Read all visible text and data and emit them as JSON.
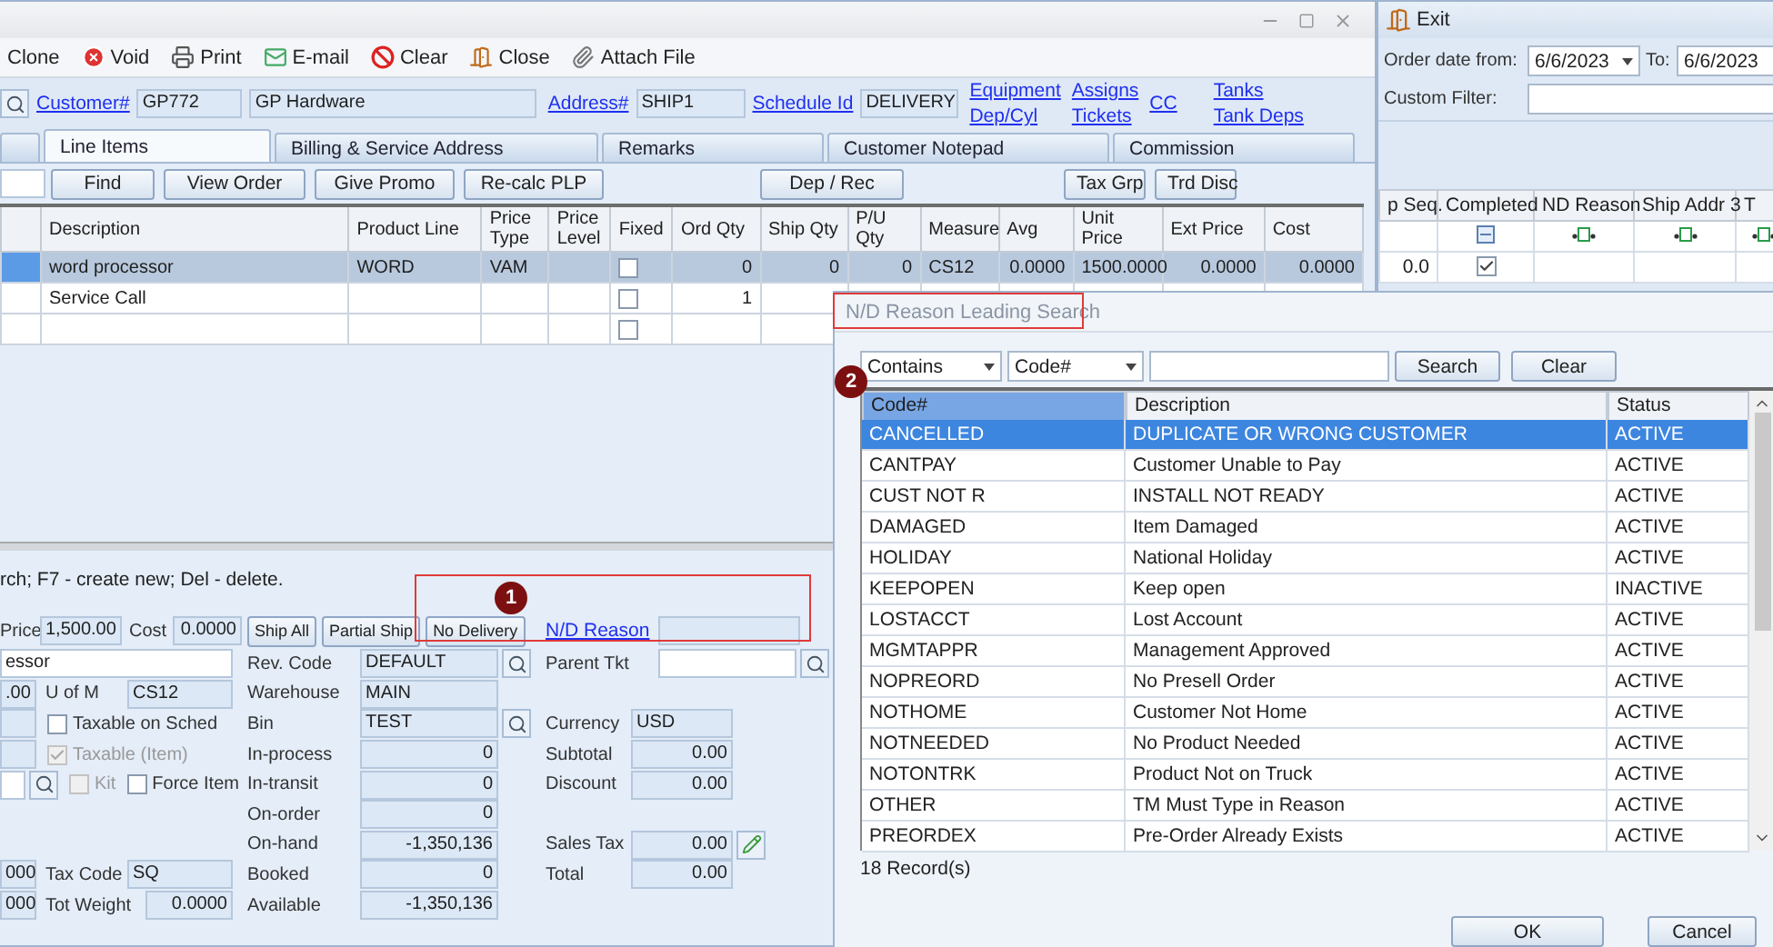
{
  "main_window": {
    "toolbar": [
      {
        "label": "Clone"
      },
      {
        "label": "Void"
      },
      {
        "label": "Print"
      },
      {
        "label": "E-mail"
      },
      {
        "label": "Clear"
      },
      {
        "label": "Close"
      },
      {
        "label": "Attach File"
      }
    ],
    "header": {
      "customer_link": "Customer#",
      "customer_id": "GP772",
      "customer_name": "GP Hardware",
      "address_link": "Address#",
      "address_id": "SHIP1",
      "schedule_link": "Schedule Id",
      "schedule_id": "DELIVERY",
      "link_columns": [
        {
          "links": [
            "Equipment",
            "Dep/Cyl"
          ]
        },
        {
          "links": [
            "Assigns",
            "Tickets"
          ]
        },
        {
          "links": [
            "CC"
          ]
        },
        {
          "links": [
            "Tanks",
            "Tank Deps"
          ]
        }
      ]
    },
    "tabs": [
      {
        "label": "Line Items",
        "selected": true
      },
      {
        "label": "Billing & Service Address",
        "selected": false
      },
      {
        "label": "Remarks",
        "selected": false
      },
      {
        "label": "Customer Notepad",
        "selected": false
      },
      {
        "label": "Commission",
        "selected": false
      }
    ],
    "button_groups": [
      {
        "buttons": [
          "Find",
          "View Order",
          "Give Promo",
          "Re-calc PLP"
        ]
      },
      {
        "buttons": [
          "Dep / Rec"
        ]
      },
      {
        "buttons": [
          "Tax Grp",
          "Trd Disc"
        ]
      }
    ],
    "grid": {
      "columns": [
        {
          "label": "Description",
          "kind": "text"
        },
        {
          "label": "Product Line",
          "kind": "text"
        },
        {
          "label": "Price Type",
          "kind": "text"
        },
        {
          "label": "Price Level",
          "kind": "text"
        },
        {
          "label": "Fixed",
          "kind": "check"
        },
        {
          "label": "Ord Qty",
          "kind": "number"
        },
        {
          "label": "Ship Qty",
          "kind": "number"
        },
        {
          "label": "P/U Qty",
          "kind": "number"
        },
        {
          "label": "Measure",
          "kind": "text"
        },
        {
          "label": "Avg",
          "kind": "number"
        },
        {
          "label": "Unit Price",
          "kind": "number"
        },
        {
          "label": "Ext Price",
          "kind": "number"
        },
        {
          "label": "Cost",
          "kind": "number"
        }
      ],
      "rows": [
        {
          "selected": true,
          "cells": [
            "word processor",
            "WORD",
            "VAM",
            null,
            false,
            "0",
            "0",
            "0",
            "CS12",
            "0.0000",
            "1500.0000",
            "0.0000",
            "0.0000"
          ]
        },
        {
          "selected": false,
          "cells": [
            "Service Call",
            null,
            null,
            null,
            false,
            "1",
            null,
            null,
            null,
            null,
            null,
            null,
            null
          ]
        },
        {
          "selected": false,
          "cells": [
            null,
            null,
            null,
            null,
            false,
            null,
            null,
            null,
            null,
            null,
            null,
            null,
            null
          ]
        }
      ]
    },
    "hint": "rch; F7 - create new; Del - delete.",
    "item": {
      "price_label": "Price",
      "price": "1,500.00",
      "cost_label": "Cost",
      "cost": "0.0000",
      "description": "essor",
      "qty": ".00",
      "uom_label": "U of M",
      "uom": "CS12",
      "weight_a": "000",
      "tax_code_label": "Tax Code",
      "tax_code": "SQ",
      "weight_b": "000",
      "tot_weight_label": "Tot Weight",
      "tot_weight": "0.0000"
    },
    "checkboxes": [
      {
        "label": "Taxable on Sched",
        "checked": false,
        "disabled": false
      },
      {
        "label": "Taxable (Item)",
        "checked": true,
        "disabled": true
      },
      {
        "label": "Kit",
        "checked": false,
        "disabled": true
      },
      {
        "label": "Force Item",
        "checked": false,
        "disabled": false
      }
    ],
    "action_buttons": [
      "Ship All",
      "Partial Ship",
      "No Delivery"
    ],
    "inventory": [
      {
        "label": "Rev. Code",
        "value": "DEFAULT",
        "kind": "text",
        "lookup": true
      },
      {
        "label": "Warehouse",
        "value": "MAIN",
        "kind": "text",
        "lookup": false
      },
      {
        "label": "Bin",
        "value": "TEST",
        "kind": "text",
        "lookup": true
      },
      {
        "label": "In-process",
        "value": "0",
        "kind": "number",
        "lookup": false
      },
      {
        "label": "In-transit",
        "value": "0",
        "kind": "number",
        "lookup": false
      },
      {
        "label": "On-order",
        "value": "0",
        "kind": "number",
        "lookup": false
      },
      {
        "label": "On-hand",
        "value": "-1,350,136",
        "kind": "number",
        "lookup": false
      },
      {
        "label": "Booked",
        "value": "0",
        "kind": "number",
        "lookup": false
      },
      {
        "label": "Available",
        "value": "-1,350,136",
        "kind": "number",
        "lookup": false
      }
    ],
    "nd_reason_link": "N/D Reason",
    "parent_tkt_label": "Parent Tkt",
    "totals": [
      {
        "label": "Currency",
        "value": "USD",
        "kind": "text"
      },
      {
        "label": "Subtotal",
        "value": "0.00",
        "kind": "amount"
      },
      {
        "label": "Discount",
        "value": "0.00",
        "kind": "amount"
      },
      {
        "label": "Sales Tax",
        "value": "0.00",
        "kind": "tax"
      },
      {
        "label": "Total",
        "value": "0.00",
        "kind": "amount"
      }
    ]
  },
  "list_window": {
    "exit": "Exit",
    "date_from_label": "Order date from:",
    "date_from": "6/6/2023",
    "to_label": "To:",
    "date_to": "6/6/2023",
    "custom_filter_label": "Custom Filter:",
    "columns": [
      {
        "label": "p Seq.",
        "kind": "number"
      },
      {
        "label": "Completed",
        "kind": "check"
      },
      {
        "label": "ND Reason",
        "kind": "text"
      },
      {
        "label": "Ship Addr 3",
        "kind": "text"
      },
      {
        "label": "T",
        "kind": "text"
      }
    ],
    "rows": [
      {
        "seq": "0.0",
        "completed": true
      }
    ]
  },
  "dialog": {
    "title": "N/D Reason Leading Search",
    "match_mode": "Contains",
    "search_field": "Code#",
    "search_button": "Search",
    "clear_button": "Clear",
    "columns": [
      {
        "label": "Code#",
        "sorted": true
      },
      {
        "label": "Description",
        "sorted": false
      },
      {
        "label": "Status",
        "sorted": false
      }
    ],
    "rows": [
      {
        "code": "CANCELLED",
        "description": "DUPLICATE OR WRONG CUSTOMER",
        "status": "ACTIVE",
        "selected": true
      },
      {
        "code": "CANTPAY",
        "description": "Customer Unable to Pay",
        "status": "ACTIVE",
        "selected": false
      },
      {
        "code": "CUST NOT R",
        "description": "INSTALL NOT READY",
        "status": "ACTIVE",
        "selected": false
      },
      {
        "code": "DAMAGED",
        "description": "Item Damaged",
        "status": "ACTIVE",
        "selected": false
      },
      {
        "code": "HOLIDAY",
        "description": "National Holiday",
        "status": "ACTIVE",
        "selected": false
      },
      {
        "code": "KEEPOPEN",
        "description": "Keep open",
        "status": "INACTIVE",
        "selected": false
      },
      {
        "code": "LOSTACCT",
        "description": "Lost Account",
        "status": "ACTIVE",
        "selected": false
      },
      {
        "code": "MGMTAPPR",
        "description": "Management Approved",
        "status": "ACTIVE",
        "selected": false
      },
      {
        "code": "NOPREORD",
        "description": "No Presell Order",
        "status": "ACTIVE",
        "selected": false
      },
      {
        "code": "NOTHOME",
        "description": "Customer Not Home",
        "status": "ACTIVE",
        "selected": false
      },
      {
        "code": "NOTNEEDED",
        "description": "No Product Needed",
        "status": "ACTIVE",
        "selected": false
      },
      {
        "code": "NOTONTRK",
        "description": "Product Not on Truck",
        "status": "ACTIVE",
        "selected": false
      },
      {
        "code": "OTHER",
        "description": "TM Must Type in Reason",
        "status": "ACTIVE",
        "selected": false
      },
      {
        "code": "PREORDEX",
        "description": "Pre-Order Already Exists",
        "status": "ACTIVE",
        "selected": false
      }
    ],
    "record_count": "18 Record(s)",
    "ok_button": "OK",
    "cancel_button": "Cancel"
  },
  "annotations": [
    {
      "label": "1"
    },
    {
      "label": "2"
    }
  ]
}
